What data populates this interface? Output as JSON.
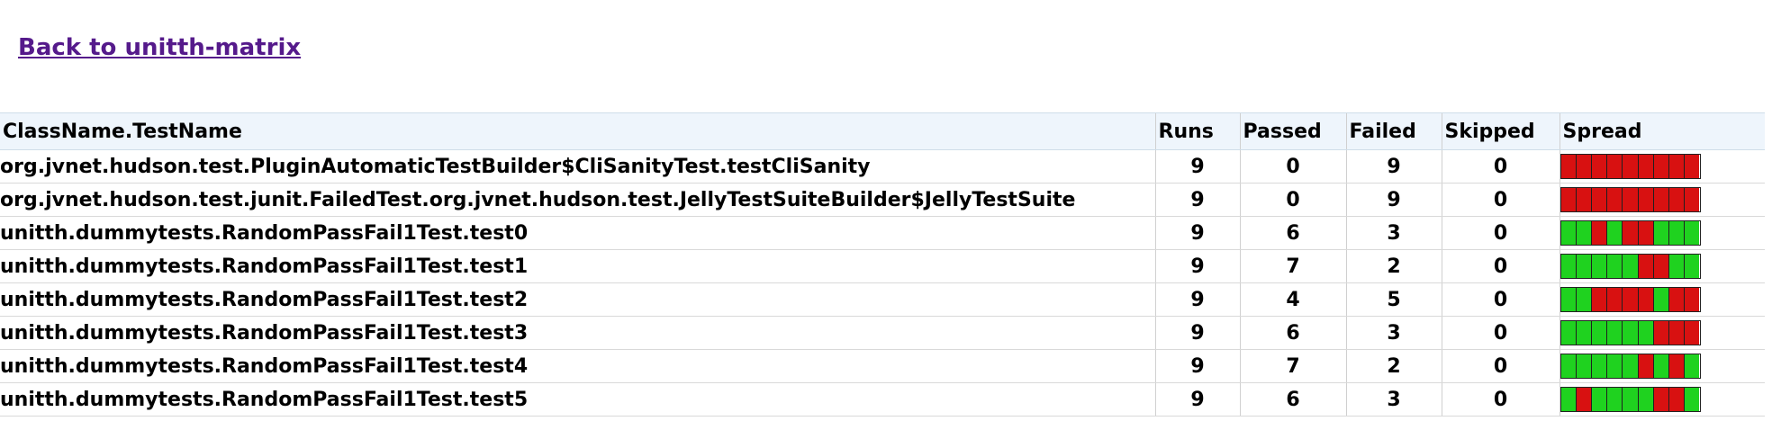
{
  "back_link": "Back to unitth-matrix",
  "table": {
    "headers": [
      "ClassName.TestName",
      "Runs",
      "Passed",
      "Failed",
      "Skipped",
      "Spread"
    ],
    "rows": [
      {
        "name": "org.jvnet.hudson.test.PluginAutomaticTestBuilder$CliSanityTest.testCliSanity",
        "runs": "9",
        "passed": "0",
        "failed": "9",
        "skipped": "0",
        "spread": [
          "fail",
          "fail",
          "fail",
          "fail",
          "fail",
          "fail",
          "fail",
          "fail",
          "fail"
        ]
      },
      {
        "name": "org.jvnet.hudson.test.junit.FailedTest.org.jvnet.hudson.test.JellyTestSuiteBuilder$JellyTestSuite",
        "runs": "9",
        "passed": "0",
        "failed": "9",
        "skipped": "0",
        "spread": [
          "fail",
          "fail",
          "fail",
          "fail",
          "fail",
          "fail",
          "fail",
          "fail",
          "fail"
        ]
      },
      {
        "name": "unitth.dummytests.RandomPassFail1Test.test0",
        "runs": "9",
        "passed": "6",
        "failed": "3",
        "skipped": "0",
        "spread": [
          "pass",
          "pass",
          "fail",
          "pass",
          "fail",
          "fail",
          "pass",
          "pass",
          "pass"
        ]
      },
      {
        "name": "unitth.dummytests.RandomPassFail1Test.test1",
        "runs": "9",
        "passed": "7",
        "failed": "2",
        "skipped": "0",
        "spread": [
          "pass",
          "pass",
          "pass",
          "pass",
          "pass",
          "fail",
          "fail",
          "pass",
          "pass"
        ]
      },
      {
        "name": "unitth.dummytests.RandomPassFail1Test.test2",
        "runs": "9",
        "passed": "4",
        "failed": "5",
        "skipped": "0",
        "spread": [
          "pass",
          "pass",
          "fail",
          "fail",
          "fail",
          "fail",
          "pass",
          "fail",
          "fail"
        ]
      },
      {
        "name": "unitth.dummytests.RandomPassFail1Test.test3",
        "runs": "9",
        "passed": "6",
        "failed": "3",
        "skipped": "0",
        "spread": [
          "pass",
          "pass",
          "pass",
          "pass",
          "pass",
          "pass",
          "fail",
          "fail",
          "fail"
        ]
      },
      {
        "name": "unitth.dummytests.RandomPassFail1Test.test4",
        "runs": "9",
        "passed": "7",
        "failed": "2",
        "skipped": "0",
        "spread": [
          "pass",
          "pass",
          "pass",
          "pass",
          "pass",
          "fail",
          "pass",
          "fail",
          "pass"
        ]
      },
      {
        "name": "unitth.dummytests.RandomPassFail1Test.test5",
        "runs": "9",
        "passed": "6",
        "failed": "3",
        "skipped": "0",
        "spread": [
          "pass",
          "fail",
          "pass",
          "pass",
          "pass",
          "pass",
          "fail",
          "fail",
          "pass"
        ]
      }
    ]
  },
  "colors": {
    "pass": "#1fd21f",
    "fail": "#d81111",
    "link": "#551a8b",
    "header_bg": "#eef5fc"
  }
}
